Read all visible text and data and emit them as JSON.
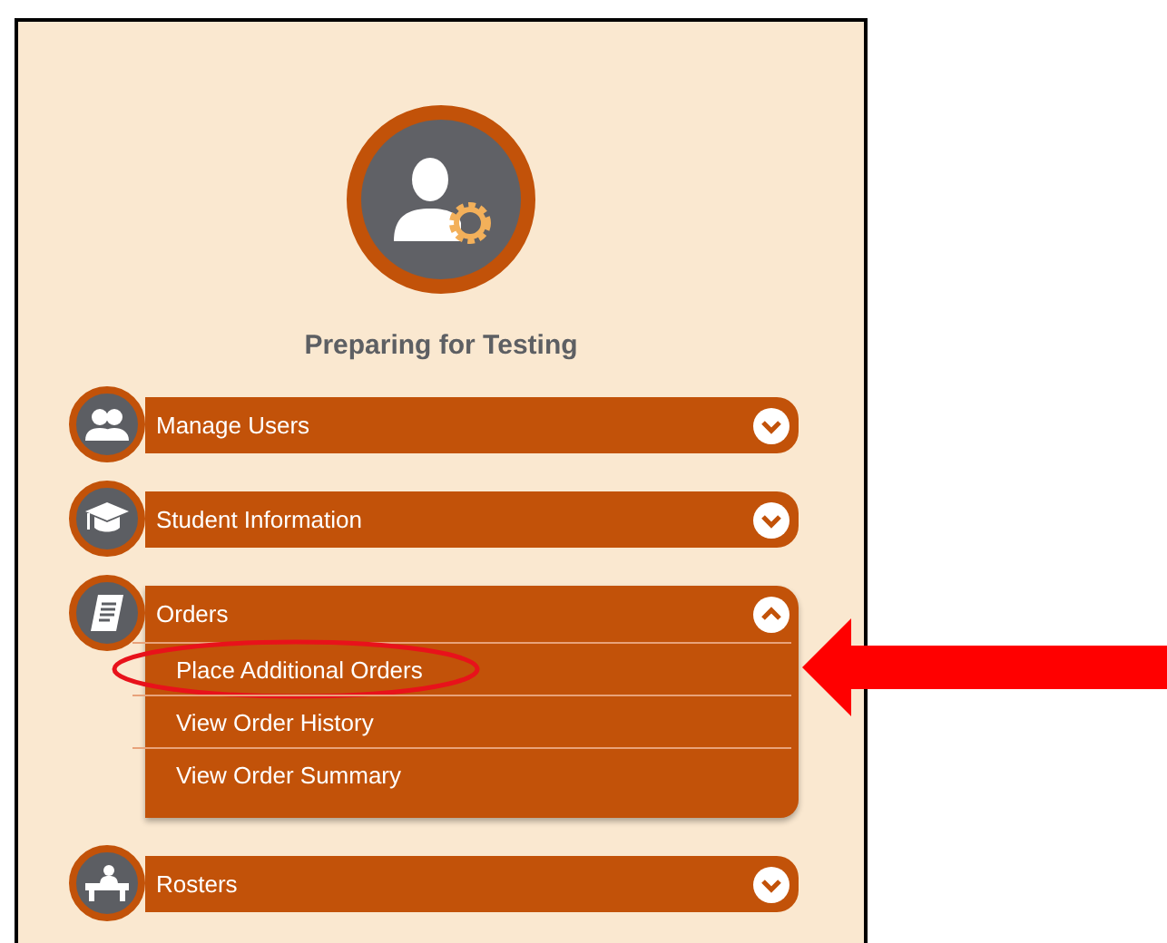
{
  "title": "Preparing for Testing",
  "sections": [
    {
      "label": "Manage Users",
      "kind": "users",
      "expanded": false
    },
    {
      "label": "Student Information",
      "kind": "student",
      "expanded": false
    },
    {
      "label": "Orders",
      "kind": "orders",
      "expanded": true,
      "children": [
        {
          "label": "Place Additional Orders",
          "highlighted": true
        },
        {
          "label": "View Order History",
          "highlighted": false
        },
        {
          "label": "View Order Summary",
          "highlighted": false
        }
      ]
    },
    {
      "label": "Rosters",
      "kind": "rosters",
      "expanded": false
    }
  ]
}
